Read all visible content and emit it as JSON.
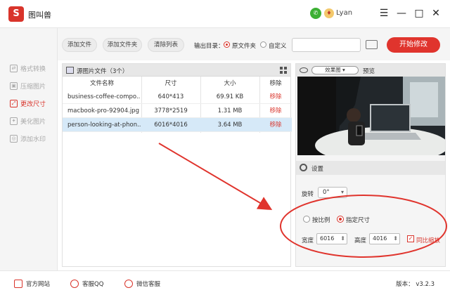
{
  "app": {
    "title": "图叫兽",
    "logo_char": "S",
    "user": "Lyan"
  },
  "window": {
    "minimize": "—",
    "maximize": "□",
    "close": "✕",
    "menu": "☰"
  },
  "sidebar": {
    "items": [
      {
        "label": "格式转换",
        "icon": "format-icon"
      },
      {
        "label": "压缩图片",
        "icon": "compress-icon"
      },
      {
        "label": "更改尺寸",
        "icon": "resize-icon",
        "active": true
      },
      {
        "label": "美化图片",
        "icon": "beautify-icon"
      },
      {
        "label": "添加水印",
        "icon": "watermark-icon"
      }
    ]
  },
  "toolbar": {
    "add_file": "添加文件",
    "add_folder": "添加文件夹",
    "clear_list": "清除列表",
    "output_label": "输出目录：",
    "opt_source": "原文件夹",
    "opt_custom": "自定义",
    "path_value": "",
    "start": "开始修改"
  },
  "file_panel": {
    "title": "源图片文件（3个）",
    "columns": [
      "文件名称",
      "尺寸",
      "大小",
      "移除"
    ],
    "rows": [
      {
        "name": "business-coffee-compo...",
        "size": "640*413",
        "filesize": "69.91 KB",
        "remove": "移除"
      },
      {
        "name": "macbook-pro-92904.jpg",
        "size": "3778*2519",
        "filesize": "1.31 MB",
        "remove": "移除"
      },
      {
        "name": "person-looking-at-phon...",
        "size": "6016*4016",
        "filesize": "3.64 MB",
        "remove": "移除"
      }
    ]
  },
  "preview": {
    "effect": "效果图",
    "label": "预览"
  },
  "settings": {
    "title": "设置",
    "rotate_label": "旋转",
    "rotate_value": "0°",
    "opt_ratio": "按比例",
    "opt_size": "指定尺寸",
    "width_label": "宽度",
    "width_value": "6016",
    "height_label": "高度",
    "height_value": "4016",
    "keep_ratio": "同比缩放"
  },
  "footer": {
    "website": "官方网站",
    "qq": "客服QQ",
    "wechat": "微信客服",
    "version": "版本： v3.2.3"
  }
}
